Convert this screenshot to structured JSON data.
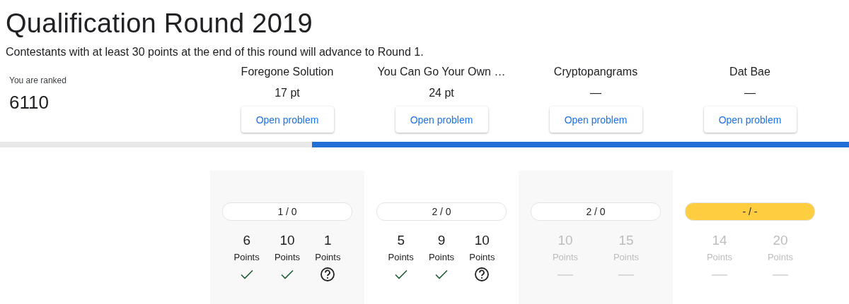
{
  "title": "Qualification Round 2019",
  "subtitle": "Contestants with at least 30 points at the end of this round will advance to Round 1.",
  "rank": {
    "label": "You are ranked",
    "value": "6110"
  },
  "progress": {
    "level": 0.6325
  },
  "problems": [
    {
      "name": "Foregone Solution",
      "score": "17 pt",
      "button": "Open problem",
      "attempts": "1 / 0",
      "color": "#ffffff",
      "tests": [
        {
          "points": "6",
          "unit": "Points",
          "kind": "correct",
          "disabled": false
        },
        {
          "points": "10",
          "unit": "Points",
          "kind": "correct",
          "disabled": false
        },
        {
          "points": "1",
          "unit": "Points",
          "kind": "pending",
          "disabled": false
        }
      ]
    },
    {
      "name": "You Can Go Your Own …",
      "score": "24 pt",
      "button": "Open problem",
      "attempts": "2 / 0",
      "color": "#ffffff",
      "tests": [
        {
          "points": "5",
          "unit": "Points",
          "kind": "correct",
          "disabled": false
        },
        {
          "points": "9",
          "unit": "Points",
          "kind": "correct",
          "disabled": false
        },
        {
          "points": "10",
          "unit": "Points",
          "kind": "pending",
          "disabled": false
        }
      ]
    },
    {
      "name": "Cryptopangrams",
      "score": "—",
      "button": "Open problem",
      "attempts": "2 / 0",
      "color": "#ffffff",
      "tests": [
        {
          "points": "10",
          "unit": "Points",
          "kind": "none",
          "disabled": true
        },
        {
          "points": "15",
          "unit": "Points",
          "kind": "none",
          "disabled": true
        }
      ]
    },
    {
      "name": "Dat Bae",
      "score": "—",
      "button": "Open problem",
      "attempts": "- / -",
      "color": "#ffcd40",
      "tests": [
        {
          "points": "14",
          "unit": "Points",
          "kind": "none",
          "disabled": true
        },
        {
          "points": "20",
          "unit": "Points",
          "kind": "none",
          "disabled": true
        }
      ]
    }
  ]
}
